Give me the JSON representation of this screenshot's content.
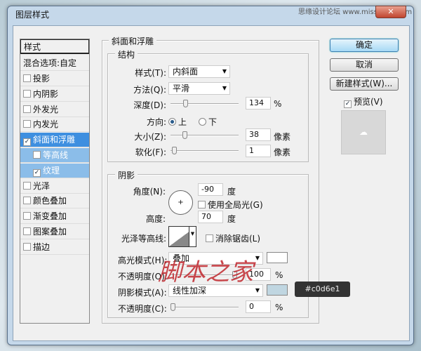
{
  "window": {
    "title": "图层样式",
    "watermark_site": "思缘设计论坛 www.missyuan.com",
    "close_icon": "close-x"
  },
  "sidebar": {
    "header": "样式",
    "blend": "混合选项:自定",
    "items": [
      {
        "label": "投影",
        "checked": false
      },
      {
        "label": "内阴影",
        "checked": false
      },
      {
        "label": "外发光",
        "checked": false
      },
      {
        "label": "内发光",
        "checked": false
      },
      {
        "label": "斜面和浮雕",
        "checked": true,
        "selected": true
      },
      {
        "label": "等高线",
        "checked": false,
        "sub": true
      },
      {
        "label": "纹理",
        "checked": true,
        "sub": true
      },
      {
        "label": "光泽",
        "checked": false
      },
      {
        "label": "颜色叠加",
        "checked": false
      },
      {
        "label": "渐变叠加",
        "checked": false
      },
      {
        "label": "图案叠加",
        "checked": false
      },
      {
        "label": "描边",
        "checked": false
      }
    ]
  },
  "bevel": {
    "title": "斜面和浮雕",
    "structure": {
      "title": "结构",
      "style_label": "样式(T):",
      "style_value": "内斜面",
      "technique_label": "方法(Q):",
      "technique_value": "平滑",
      "depth_label": "深度(D):",
      "depth_value": "134",
      "depth_unit": "%",
      "direction_label": "方向:",
      "dir_up": "上",
      "dir_down": "下",
      "size_label": "大小(Z):",
      "size_value": "38",
      "size_unit": "像素",
      "soften_label": "软化(F):",
      "soften_value": "1",
      "soften_unit": "像素"
    },
    "shading": {
      "title": "阴影",
      "angle_label": "角度(N):",
      "angle_value": "-90",
      "angle_unit": "度",
      "global_light": "使用全局光(G)",
      "altitude_label": "高度:",
      "altitude_value": "70",
      "altitude_unit": "度",
      "gloss_label": "光泽等高线:",
      "antialias": "消除锯齿(L)",
      "highlight_label": "高光模式(H):",
      "highlight_value": "叠加",
      "highlight_opacity_label": "不透明度(O):",
      "highlight_opacity_value": "100",
      "shadow_label": "阴影模式(A):",
      "shadow_value": "线性加深",
      "shadow_opacity_label": "不透明度(C):",
      "shadow_opacity_value": "0",
      "pct": "%",
      "highlight_color": "#ffffff",
      "shadow_color": "#c0d6e1",
      "tooltip": "#c0d6e1"
    }
  },
  "buttons": {
    "ok": "确定",
    "cancel": "取消",
    "new_style": "新建样式(W)...",
    "preview": "预览(V)"
  },
  "watermark": "脚本之家"
}
